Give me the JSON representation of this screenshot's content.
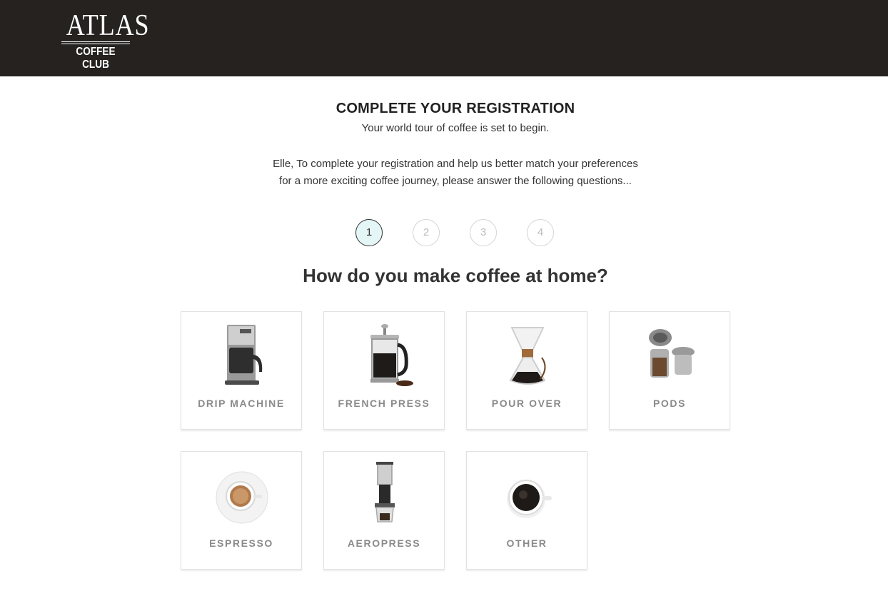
{
  "header": {
    "logo_main": "ATLAS",
    "logo_sub": "COFFEE CLUB",
    "background": "#252220"
  },
  "registration": {
    "title": "COMPLETE YOUR REGISTRATION",
    "subtitle": "Your world tour of coffee is set to begin.",
    "intro": "Elle, To complete your registration and help us better match your preferences for a more exciting coffee journey, please answer the following questions..."
  },
  "steps": {
    "current": 1,
    "labels": [
      "1",
      "2",
      "3",
      "4"
    ]
  },
  "question": {
    "text": "How do you make coffee at home?",
    "options": [
      {
        "label": "DRIP MACHINE",
        "icon": "drip-machine-icon"
      },
      {
        "label": "FRENCH PRESS",
        "icon": "french-press-icon"
      },
      {
        "label": "POUR OVER",
        "icon": "pour-over-icon"
      },
      {
        "label": "PODS",
        "icon": "pods-icon"
      },
      {
        "label": "ESPRESSO",
        "icon": "espresso-icon"
      },
      {
        "label": "AEROPRESS",
        "icon": "aeropress-icon"
      },
      {
        "label": "OTHER",
        "icon": "other-coffee-cup-icon"
      }
    ]
  },
  "colors": {
    "active_step_fill": "#e4f6f6",
    "card_label": "#8a8a8a"
  }
}
